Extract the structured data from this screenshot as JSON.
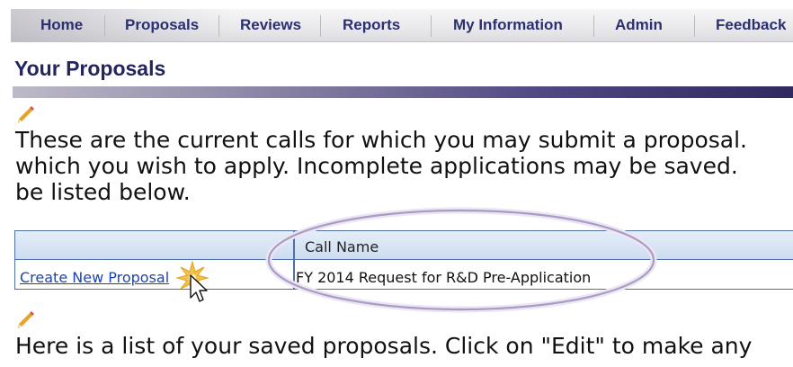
{
  "nav": {
    "items": [
      {
        "label": "Home"
      },
      {
        "label": "Proposals"
      },
      {
        "label": "Reviews"
      },
      {
        "label": "Reports"
      },
      {
        "label": "My Information"
      },
      {
        "label": "Admin"
      },
      {
        "label": "Feedback"
      }
    ]
  },
  "page": {
    "title": "Your Proposals",
    "intro_lines": [
      "These are the current calls for which you may submit a proposal.",
      "which you wish to apply. Incomplete applications may be saved.",
      "be listed below."
    ],
    "saved_text": "Here is a list of your saved proposals. Click on \"Edit\" to make any"
  },
  "calls_table": {
    "columns": [
      "",
      "Call Name"
    ],
    "rows": [
      {
        "action": "Create New Proposal",
        "call_name": "FY 2014 Request for R&D Pre-Application"
      }
    ]
  },
  "icons": {
    "edit": "pencil-icon",
    "cursor": "mouse-pointer-icon",
    "click": "click-burst-icon"
  },
  "colors": {
    "nav_text": "#2b2f6e",
    "title_text": "#23265e",
    "link": "#1a45b5",
    "table_border": "#4e6fa8",
    "highlight_ellipse": "#a89cc4"
  }
}
